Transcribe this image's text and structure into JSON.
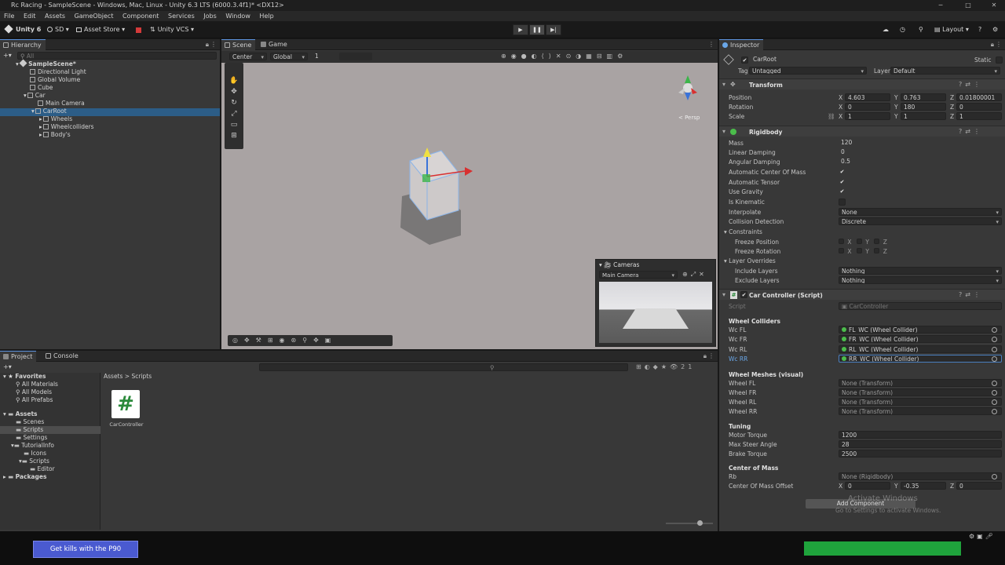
{
  "window": {
    "title": "Rc Racing - SampleScene - Windows, Mac, Linux - Unity 6.3 LTS (6000.3.4f1)* <DX12>",
    "min": "─",
    "max": "□",
    "close": "✕"
  },
  "menu": [
    "File",
    "Edit",
    "Assets",
    "GameObject",
    "Component",
    "Services",
    "Jobs",
    "Window",
    "Help"
  ],
  "toolbar": {
    "account": "Unity 6",
    "user": "SD",
    "asset_store": "Asset Store",
    "vcs": "Unity VCS",
    "layout": "Layout"
  },
  "hierarchy": {
    "tab": "Hierarchy",
    "search_placeholder": "All",
    "items": [
      {
        "label": "SampleScene*",
        "depth": 0,
        "icon": "unity-scene-icon"
      },
      {
        "label": "Directional Light",
        "depth": 1,
        "icon": "gameobject-icon"
      },
      {
        "label": "Global Volume",
        "depth": 1,
        "icon": "gameobject-icon"
      },
      {
        "label": "Cube",
        "depth": 1,
        "icon": "gameobject-icon"
      },
      {
        "label": "Car",
        "depth": 1,
        "icon": "gameobject-icon"
      },
      {
        "label": "Main Camera",
        "depth": 2,
        "icon": "gameobject-icon"
      },
      {
        "label": "CarRoot",
        "depth": 2,
        "icon": "gameobject-icon",
        "selected": true
      },
      {
        "label": "Wheels",
        "depth": 3,
        "icon": "gameobject-icon"
      },
      {
        "label": "Wheelcolliders",
        "depth": 3,
        "icon": "gameobject-icon"
      },
      {
        "label": "Body's",
        "depth": 3,
        "icon": "gameobject-icon"
      }
    ]
  },
  "scene": {
    "tabs": [
      "Scene",
      "Game"
    ],
    "pivot": "Center",
    "space": "Global",
    "grid_step": "1",
    "persp": "< Persp",
    "cameras_overlay": {
      "title": "Cameras",
      "camera": "Main Camera"
    }
  },
  "project": {
    "tabs": [
      "Project",
      "Console"
    ],
    "breadcrumb": [
      "Assets",
      "Scripts"
    ],
    "favorites": {
      "title": "Favorites",
      "items": [
        "All Materials",
        "All Models",
        "All Prefabs"
      ]
    },
    "assets": {
      "title": "Assets",
      "items": [
        {
          "label": "Scenes",
          "depth": 1
        },
        {
          "label": "Scripts",
          "depth": 1,
          "selected": true
        },
        {
          "label": "Settings",
          "depth": 1
        },
        {
          "label": "TutorialInfo",
          "depth": 1
        },
        {
          "label": "Icons",
          "depth": 2
        },
        {
          "label": "Scripts",
          "depth": 2
        },
        {
          "label": "Editor",
          "depth": 3
        }
      ]
    },
    "packages": "Packages",
    "file": {
      "name": "CarController",
      "glyph": "#"
    },
    "hidden_count": "21"
  },
  "inspector": {
    "tab": "Inspector",
    "object_name": "CarRoot",
    "static_label": "Static",
    "tag_label": "Tag",
    "tag": "Untagged",
    "layer_label": "Layer",
    "layer": "Default",
    "transform": {
      "title": "Transform",
      "position_label": "Position",
      "position": {
        "x": "4.603",
        "y": "0.763",
        "z": "0.01800001"
      },
      "rotation_label": "Rotation",
      "rotation": {
        "x": "0",
        "y": "180",
        "z": "0"
      },
      "scale_label": "Scale",
      "scale": {
        "x": "1",
        "y": "1",
        "z": "1"
      }
    },
    "rigidbody": {
      "title": "Rigidbody",
      "rows": [
        {
          "label": "Mass",
          "value": "120",
          "kind": "text"
        },
        {
          "label": "Linear Damping",
          "value": "0",
          "kind": "text"
        },
        {
          "label": "Angular Damping",
          "value": "0.5",
          "kind": "text"
        },
        {
          "label": "Automatic Center Of Mass",
          "value": "✔",
          "kind": "check"
        },
        {
          "label": "Automatic Tensor",
          "value": "✔",
          "kind": "check"
        },
        {
          "label": "Use Gravity",
          "value": "✔",
          "kind": "check"
        },
        {
          "label": "Is Kinematic",
          "value": "",
          "kind": "check"
        },
        {
          "label": "Interpolate",
          "value": "None",
          "kind": "dropdown"
        },
        {
          "label": "Collision Detection",
          "value": "Discrete",
          "kind": "dropdown"
        }
      ],
      "constraints": "Constraints",
      "freeze_position": "Freeze Position",
      "freeze_rotation": "Freeze Rotation",
      "axes": [
        "X",
        "Y",
        "Z"
      ],
      "layer_overrides": "Layer Overrides",
      "include_layers": "Include Layers",
      "include_value": "Nothing",
      "exclude_layers": "Exclude Layers",
      "exclude_value": "Nothing"
    },
    "car_controller": {
      "title": "Car Controller (Script)",
      "script_label": "Script",
      "script_value": "CarController",
      "wheel_colliders_header": "Wheel Colliders",
      "wheel_colliders": [
        {
          "label": "Wc FL",
          "value": "FL_WC (Wheel Collider)"
        },
        {
          "label": "Wc FR",
          "value": "FR_WC (Wheel Collider)"
        },
        {
          "label": "Wc RL",
          "value": "RL_WC (Wheel Collider)"
        },
        {
          "label": "Wc RR",
          "value": "RR_WC (Wheel Collider)"
        }
      ],
      "wheel_meshes_header": "Wheel Meshes (visual)",
      "wheel_meshes": [
        {
          "label": "Wheel FL",
          "value": "None (Transform)"
        },
        {
          "label": "Wheel FR",
          "value": "None (Transform)"
        },
        {
          "label": "Wheel RL",
          "value": "None (Transform)"
        },
        {
          "label": "Wheel RR",
          "value": "None (Transform)"
        }
      ],
      "tuning_header": "Tuning",
      "tuning": [
        {
          "label": "Motor Torque",
          "value": "1200"
        },
        {
          "label": "Max Steer Angle",
          "value": "28"
        },
        {
          "label": "Brake Torque",
          "value": "2500"
        }
      ],
      "com_header": "Center of Mass",
      "rb_label": "Rb",
      "rb_value": "None (Rigidbody)",
      "com_offset_label": "Center Of Mass Offset",
      "com_offset": {
        "x": "0",
        "y": "-0.35",
        "z": "0"
      }
    },
    "add_component": "Add Component"
  },
  "watermark": {
    "title": "Activate Windows",
    "sub": "Go to Settings to activate Windows."
  },
  "ad": {
    "text": "Get kills with the P90"
  }
}
